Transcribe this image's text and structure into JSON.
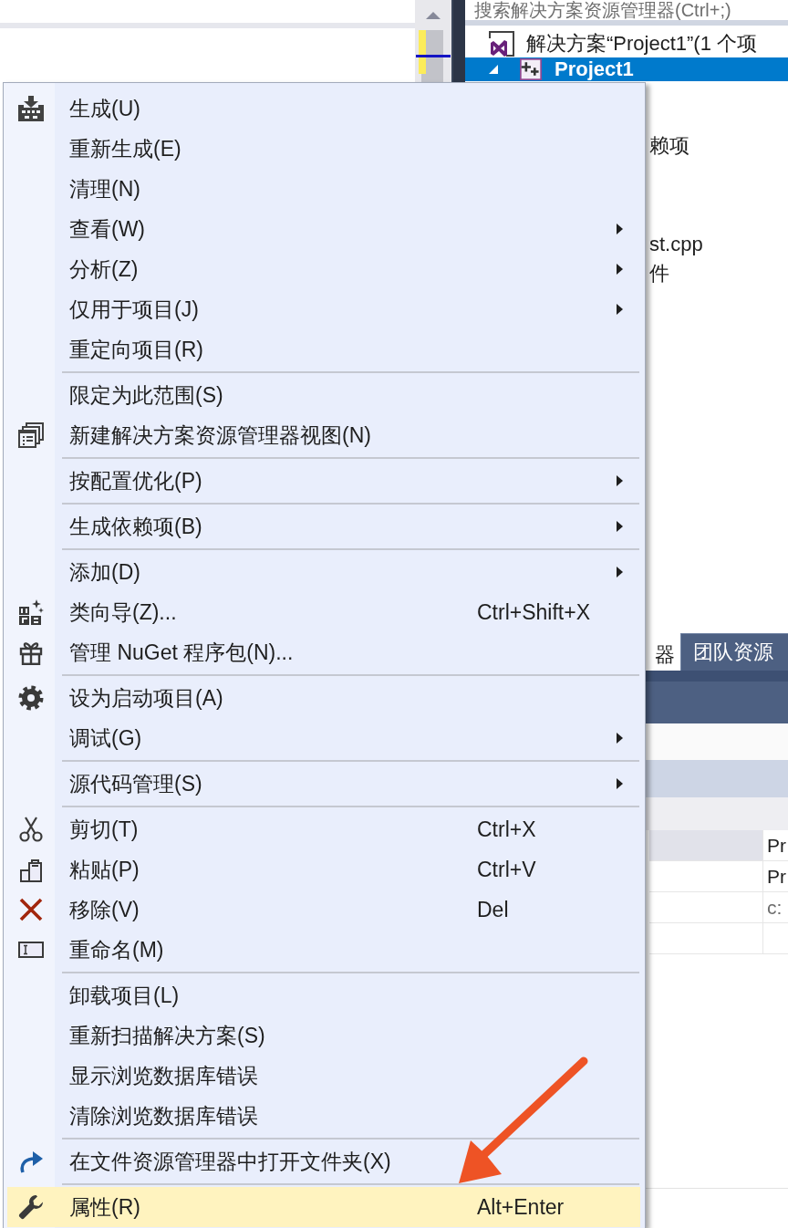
{
  "solution_explorer": {
    "search": {
      "placeholder": "搜索解决方案资源管理器(Ctrl+;)"
    },
    "tree": [
      {
        "label": "解决方案“Project1”(1 个项",
        "selected": false,
        "children": [
          {
            "label": "Project1",
            "selected": true,
            "expanded": true,
            "children": [
              {
                "label": "赖项",
                "selected": false
              },
              {
                "label": "st.cpp",
                "selected": false
              },
              {
                "label": "件",
                "selected": false
              }
            ]
          }
        ]
      }
    ]
  },
  "tabs": [
    {
      "label": "器",
      "selected": true
    },
    {
      "label": "团队资源",
      "selected": false
    }
  ],
  "properties": {
    "rows": [
      {
        "value": "Pr",
        "selected": true,
        "read_only": false
      },
      {
        "value": "Pr",
        "selected": false,
        "read_only": false
      },
      {
        "value": "c:",
        "selected": false,
        "read_only": true
      }
    ]
  },
  "context_menu": {
    "sections": [
      {
        "items": [
          {
            "label": "生成(U)",
            "submenu": false,
            "selected": false
          },
          {
            "label": "重新生成(E)",
            "submenu": false,
            "selected": false
          },
          {
            "label": "清理(N)",
            "submenu": false,
            "selected": false
          },
          {
            "label": "查看(W)",
            "submenu": true,
            "selected": false
          },
          {
            "label": "分析(Z)",
            "submenu": true,
            "selected": false
          },
          {
            "label": "仅用于项目(J)",
            "submenu": true,
            "selected": false
          },
          {
            "label": "重定向项目(R)",
            "submenu": false,
            "selected": false
          }
        ]
      },
      {
        "items": [
          {
            "label": "限定为此范围(S)",
            "submenu": false,
            "selected": false
          },
          {
            "label": "新建解决方案资源管理器视图(N)",
            "submenu": false,
            "selected": false
          }
        ]
      },
      {
        "items": [
          {
            "label": "按配置优化(P)",
            "submenu": true,
            "selected": false
          }
        ]
      },
      {
        "items": [
          {
            "label": "生成依赖项(B)",
            "submenu": true,
            "selected": false
          }
        ]
      },
      {
        "items": [
          {
            "label": "添加(D)",
            "submenu": true,
            "selected": false
          },
          {
            "label": "类向导(Z)...",
            "shortcut": "Ctrl+Shift+X",
            "submenu": false,
            "selected": false
          },
          {
            "label": "管理 NuGet 程序包(N)...",
            "submenu": false,
            "selected": false
          }
        ]
      },
      {
        "items": [
          {
            "label": "设为启动项目(A)",
            "submenu": false,
            "selected": false
          },
          {
            "label": "调试(G)",
            "submenu": true,
            "selected": false
          }
        ]
      },
      {
        "items": [
          {
            "label": "源代码管理(S)",
            "submenu": true,
            "selected": false
          }
        ]
      },
      {
        "items": [
          {
            "label": "剪切(T)",
            "shortcut": "Ctrl+X",
            "submenu": false,
            "selected": false
          },
          {
            "label": "粘贴(P)",
            "shortcut": "Ctrl+V",
            "submenu": false,
            "selected": false
          },
          {
            "label": "移除(V)",
            "shortcut": "Del",
            "submenu": false,
            "selected": false
          },
          {
            "label": "重命名(M)",
            "submenu": false,
            "selected": false
          }
        ]
      },
      {
        "items": [
          {
            "label": "卸载项目(L)",
            "submenu": false,
            "selected": false
          },
          {
            "label": "重新扫描解决方案(S)",
            "submenu": false,
            "selected": false
          },
          {
            "label": "显示浏览数据库错误",
            "submenu": false,
            "selected": false
          },
          {
            "label": "清除浏览数据库错误",
            "submenu": false,
            "selected": false
          }
        ]
      },
      {
        "items": [
          {
            "label": "在文件资源管理器中打开文件夹(X)",
            "submenu": false,
            "selected": false
          }
        ]
      },
      {
        "items": [
          {
            "label": "属性(R)",
            "shortcut": "Alt+Enter",
            "submenu": false,
            "selected": true
          }
        ]
      }
    ]
  }
}
